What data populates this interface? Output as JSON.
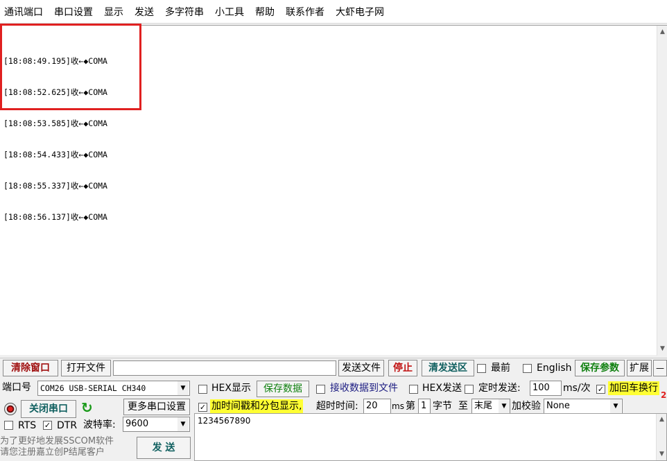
{
  "menu": [
    "通讯端口",
    "串口设置",
    "显示",
    "发送",
    "多字符串",
    "小工具",
    "帮助",
    "联系作者",
    "大虾电子网"
  ],
  "receive": {
    "lines": [
      "[18:08:49.195]收←◆COMA",
      "[18:08:52.625]收←◆COMA",
      "[18:08:53.585]收←◆COMA",
      "[18:08:54.433]收←◆COMA",
      "[18:08:55.337]收←◆COMA",
      "[18:08:56.137]收←◆COMA"
    ]
  },
  "toolbar": {
    "clear_window": "清除窗口",
    "open_file": "打开文件",
    "file_path": "",
    "send_file": "发送文件",
    "stop": "停止",
    "clear_send": "清发送区",
    "topmost": "最前",
    "english": "English",
    "save_params": "保存参数",
    "expand": "扩展",
    "collapse": "—"
  },
  "port": {
    "label": "端口号",
    "value": "COM26 USB-SERIAL CH340",
    "close_port": "关闭串口",
    "more_settings": "更多串口设置",
    "rts": "RTS",
    "dtr": "DTR",
    "baud_label": "波特率:",
    "baud_value": "9600"
  },
  "options": {
    "hex_display": "HEX显示",
    "save_data": "保存数据",
    "recv_to_file": "接收数据到文件",
    "hex_send": "HEX发送",
    "timed_send": "定时发送:",
    "interval_value": "100",
    "interval_unit": "ms/次",
    "append_crlf": "加回车换行",
    "add_timestamp": "加时间戳和分包显示,",
    "timeout_label": "超时时间:",
    "timeout_value": "20",
    "timeout_unit": "ms",
    "nth_label": "第",
    "nth_value": "1",
    "byte_label": "字节",
    "to_label": "至",
    "end_value": "末尾",
    "checksum_label": "加校验",
    "checksum_value": "None"
  },
  "send": {
    "text": "1234567890",
    "button": "发 送"
  },
  "promo": {
    "line1": "为了更好地发展SSCOM软件",
    "line2": "请您注册嘉立创P结尾客户"
  },
  "marker": "2"
}
